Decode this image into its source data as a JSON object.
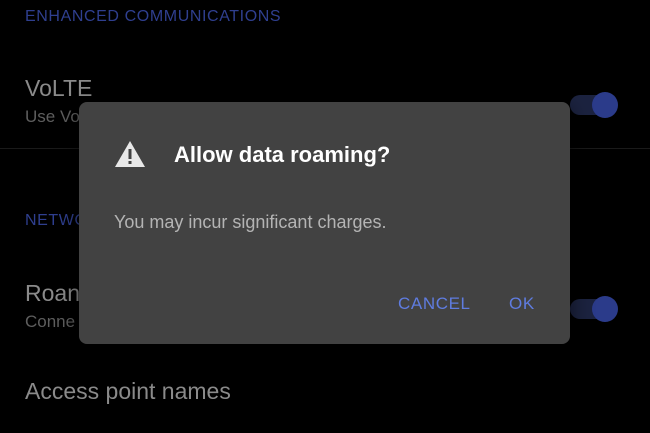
{
  "background": {
    "section_enhanced": "ENHANCED COMMUNICATIONS",
    "volte": {
      "title": "VoLTE",
      "summary_partial": "Use Vo"
    },
    "section_network_partial": "NETWO",
    "roaming": {
      "title_partial": "Roan",
      "summary_partial": "Conne"
    },
    "apn": {
      "title": "Access point names"
    }
  },
  "dialog": {
    "icon": "warning-triangle-icon",
    "title": "Allow data roaming?",
    "message": "You may incur significant charges.",
    "cancel_label": "CANCEL",
    "ok_label": "OK"
  },
  "colors": {
    "accent": "#5f7ce0",
    "dialog_bg": "#424242",
    "section_header": "#2f3f8f"
  }
}
